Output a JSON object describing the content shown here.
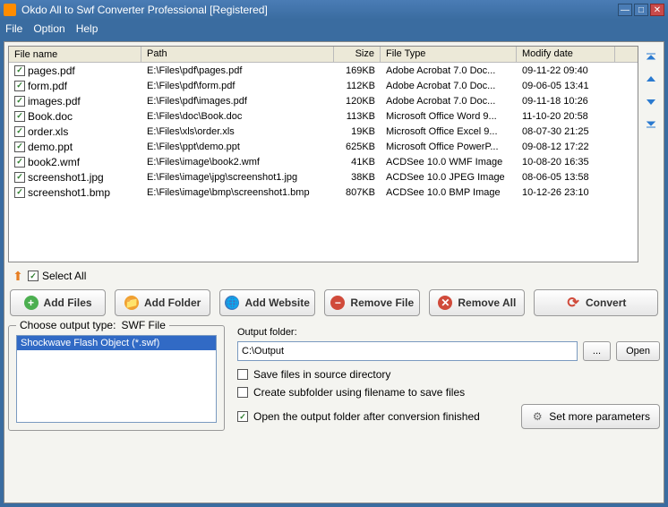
{
  "window": {
    "title": "Okdo All to Swf Converter Professional [Registered]"
  },
  "menu": {
    "file": "File",
    "option": "Option",
    "help": "Help"
  },
  "grid": {
    "headers": {
      "name": "File name",
      "path": "Path",
      "size": "Size",
      "type": "File Type",
      "date": "Modify date"
    },
    "rows": [
      {
        "name": "pages.pdf",
        "path": "E:\\Files\\pdf\\pages.pdf",
        "size": "169KB",
        "type": "Adobe Acrobat 7.0 Doc...",
        "date": "09-11-22 09:40"
      },
      {
        "name": "form.pdf",
        "path": "E:\\Files\\pdf\\form.pdf",
        "size": "112KB",
        "type": "Adobe Acrobat 7.0 Doc...",
        "date": "09-06-05 13:41"
      },
      {
        "name": "images.pdf",
        "path": "E:\\Files\\pdf\\images.pdf",
        "size": "120KB",
        "type": "Adobe Acrobat 7.0 Doc...",
        "date": "09-11-18 10:26"
      },
      {
        "name": "Book.doc",
        "path": "E:\\Files\\doc\\Book.doc",
        "size": "113KB",
        "type": "Microsoft Office Word 9...",
        "date": "11-10-20 20:58"
      },
      {
        "name": "order.xls",
        "path": "E:\\Files\\xls\\order.xls",
        "size": "19KB",
        "type": "Microsoft Office Excel 9...",
        "date": "08-07-30 21:25"
      },
      {
        "name": "demo.ppt",
        "path": "E:\\Files\\ppt\\demo.ppt",
        "size": "625KB",
        "type": "Microsoft Office PowerP...",
        "date": "09-08-12 17:22"
      },
      {
        "name": "book2.wmf",
        "path": "E:\\Files\\image\\book2.wmf",
        "size": "41KB",
        "type": "ACDSee 10.0 WMF Image",
        "date": "10-08-20 16:35"
      },
      {
        "name": "screenshot1.jpg",
        "path": "E:\\Files\\image\\jpg\\screenshot1.jpg",
        "size": "38KB",
        "type": "ACDSee 10.0 JPEG Image",
        "date": "08-06-05 13:58"
      },
      {
        "name": "screenshot1.bmp",
        "path": "E:\\Files\\image\\bmp\\screenshot1.bmp",
        "size": "807KB",
        "type": "ACDSee 10.0 BMP Image",
        "date": "10-12-26 23:10"
      }
    ]
  },
  "selectAll": "Select All",
  "buttons": {
    "addFiles": "Add Files",
    "addFolder": "Add Folder",
    "addWebsite": "Add Website",
    "removeFile": "Remove File",
    "removeAll": "Remove All",
    "convert": "Convert"
  },
  "outputType": {
    "legend": "Choose output type:",
    "current": "SWF File",
    "option": "Shockwave Flash Object (*.swf)"
  },
  "outputFolder": {
    "label": "Output folder:",
    "value": "C:\\Output",
    "browse": "...",
    "open": "Open"
  },
  "options": {
    "saveSource": "Save files in source directory",
    "createSub": "Create subfolder using filename to save files",
    "openAfter": "Open the output folder after conversion finished"
  },
  "more": "Set more parameters"
}
